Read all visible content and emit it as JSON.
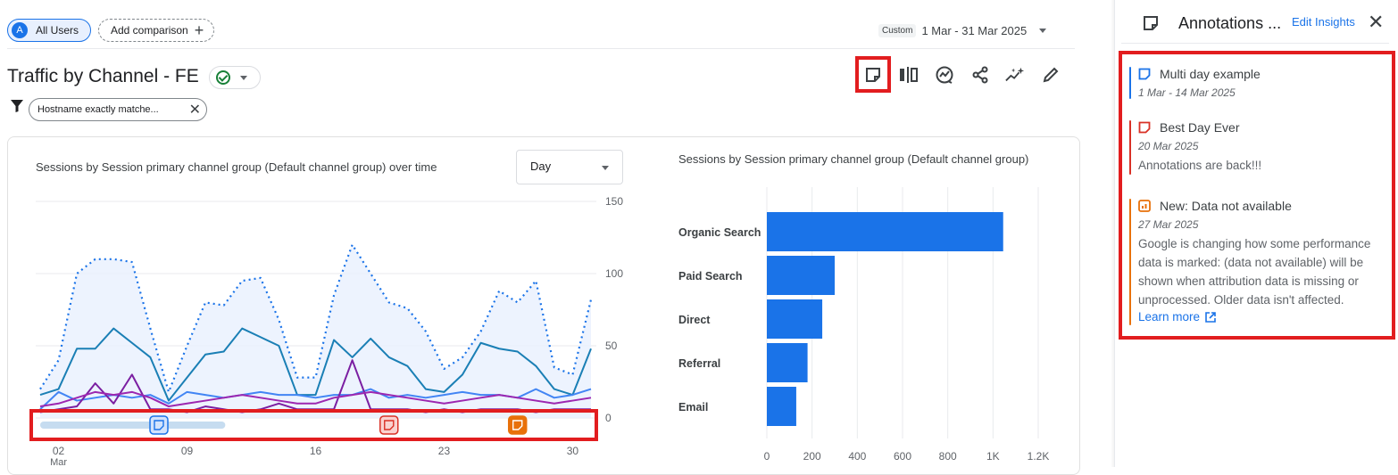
{
  "header": {
    "segment_chip": {
      "avatar": "A",
      "label": "All Users"
    },
    "add_comparison": {
      "label": "Add comparison",
      "icon": "plus-icon"
    },
    "date_range": {
      "tag": "Custom",
      "value": "1 Mar - 31 Mar 2025"
    }
  },
  "report": {
    "title": "Traffic by Channel - FE",
    "status_icon": "check-circle-icon",
    "filter_chip": "Hostname exactly matche..."
  },
  "toolbar": {
    "icons": [
      "annotation-note-icon",
      "compare-columns-icon",
      "insights-icon",
      "share-icon",
      "sparkle-insights-icon",
      "edit-pencil-icon"
    ],
    "highlight_color": "#e21d1f"
  },
  "line_chart": {
    "title": "Sessions by Session primary channel group (Default channel group) over time",
    "granularity": "Day"
  },
  "bar_chart": {
    "title": "Sessions by Session primary channel group (Default channel group)"
  },
  "chart_data": [
    {
      "type": "line",
      "x": [
        1,
        2,
        3,
        4,
        5,
        6,
        7,
        8,
        9,
        10,
        11,
        12,
        13,
        14,
        15,
        16,
        17,
        18,
        19,
        20,
        21,
        22,
        23,
        24,
        25,
        26,
        27,
        28,
        29,
        30,
        31
      ],
      "x_tick_labels": [
        "02",
        "Mar",
        "09",
        "16",
        "23",
        "30"
      ],
      "y_tick_labels": [
        "150",
        "100",
        "50",
        "0"
      ],
      "ylim": [
        0,
        150
      ],
      "series": [
        {
          "role": "comparison-dotted",
          "color": "#1a73e8",
          "values": [
            20,
            40,
            100,
            110,
            110,
            108,
            62,
            18,
            50,
            80,
            78,
            95,
            97,
            68,
            28,
            28,
            85,
            120,
            100,
            80,
            76,
            60,
            34,
            42,
            60,
            88,
            80,
            95,
            35,
            30,
            82
          ]
        },
        {
          "role": "main-1",
          "color": "#1a7fb5",
          "values": [
            16,
            20,
            48,
            48,
            62,
            52,
            42,
            12,
            28,
            44,
            46,
            62,
            56,
            50,
            16,
            16,
            54,
            42,
            55,
            42,
            36,
            20,
            18,
            30,
            52,
            48,
            46,
            36,
            20,
            16,
            48
          ]
        },
        {
          "role": "main-2",
          "color": "#4285f4",
          "values": [
            6,
            18,
            12,
            14,
            16,
            14,
            16,
            10,
            18,
            16,
            14,
            16,
            18,
            16,
            16,
            14,
            16,
            16,
            20,
            14,
            16,
            14,
            16,
            18,
            16,
            16,
            14,
            20,
            14,
            16,
            20
          ]
        },
        {
          "role": "main-3",
          "color": "#7b1fa2",
          "values": [
            4,
            6,
            8,
            24,
            10,
            30,
            6,
            6,
            4,
            8,
            6,
            4,
            6,
            10,
            6,
            6,
            6,
            40,
            6,
            6,
            6,
            4,
            6,
            4,
            6,
            6,
            6,
            4,
            6,
            6,
            6
          ]
        },
        {
          "role": "main-4",
          "color": "#9c27b0",
          "values": [
            8,
            10,
            14,
            18,
            16,
            18,
            14,
            8,
            10,
            12,
            14,
            16,
            14,
            12,
            10,
            10,
            14,
            16,
            18,
            16,
            14,
            12,
            10,
            12,
            14,
            16,
            14,
            12,
            10,
            12,
            14
          ]
        }
      ],
      "annotation_markers": [
        {
          "kind": "range",
          "from": 1,
          "to": 14,
          "color": "#1a73e8"
        },
        {
          "kind": "point",
          "at": 20,
          "color": "#d93025"
        },
        {
          "kind": "point",
          "at": 27,
          "color": "#e8710a"
        }
      ]
    },
    {
      "type": "bar",
      "orientation": "horizontal",
      "categories": [
        "Organic Search",
        "Paid Search",
        "Direct",
        "Referral",
        "Email"
      ],
      "values": [
        1045,
        300,
        245,
        180,
        130
      ],
      "color": "#1a73e8",
      "xlim": [
        0,
        1250
      ],
      "x_tick_labels": [
        "0",
        "200",
        "400",
        "600",
        "800",
        "1K",
        "1.2K"
      ]
    }
  ],
  "sidebar": {
    "title": "Annotations ...",
    "edit_link": "Edit Insights",
    "close_icon": "close-icon",
    "annotations": [
      {
        "title": "Multi day example",
        "date": "1 Mar - 14 Mar 2025",
        "color": "#1a73e8",
        "icon": "note-icon",
        "body": ""
      },
      {
        "title": "Best Day Ever",
        "date": "20 Mar 2025",
        "color": "#d93025",
        "icon": "note-icon",
        "body": "Annotations are back!!!"
      },
      {
        "title": "New: Data not available",
        "date": "27 Mar 2025",
        "color": "#e8710a",
        "icon": "system-note-icon",
        "body": "Google is changing how some performance data is marked: (data not available) will be shown when attribution data is missing or unprocessed. Older data isn't affected.",
        "link": "Learn more"
      }
    ]
  }
}
